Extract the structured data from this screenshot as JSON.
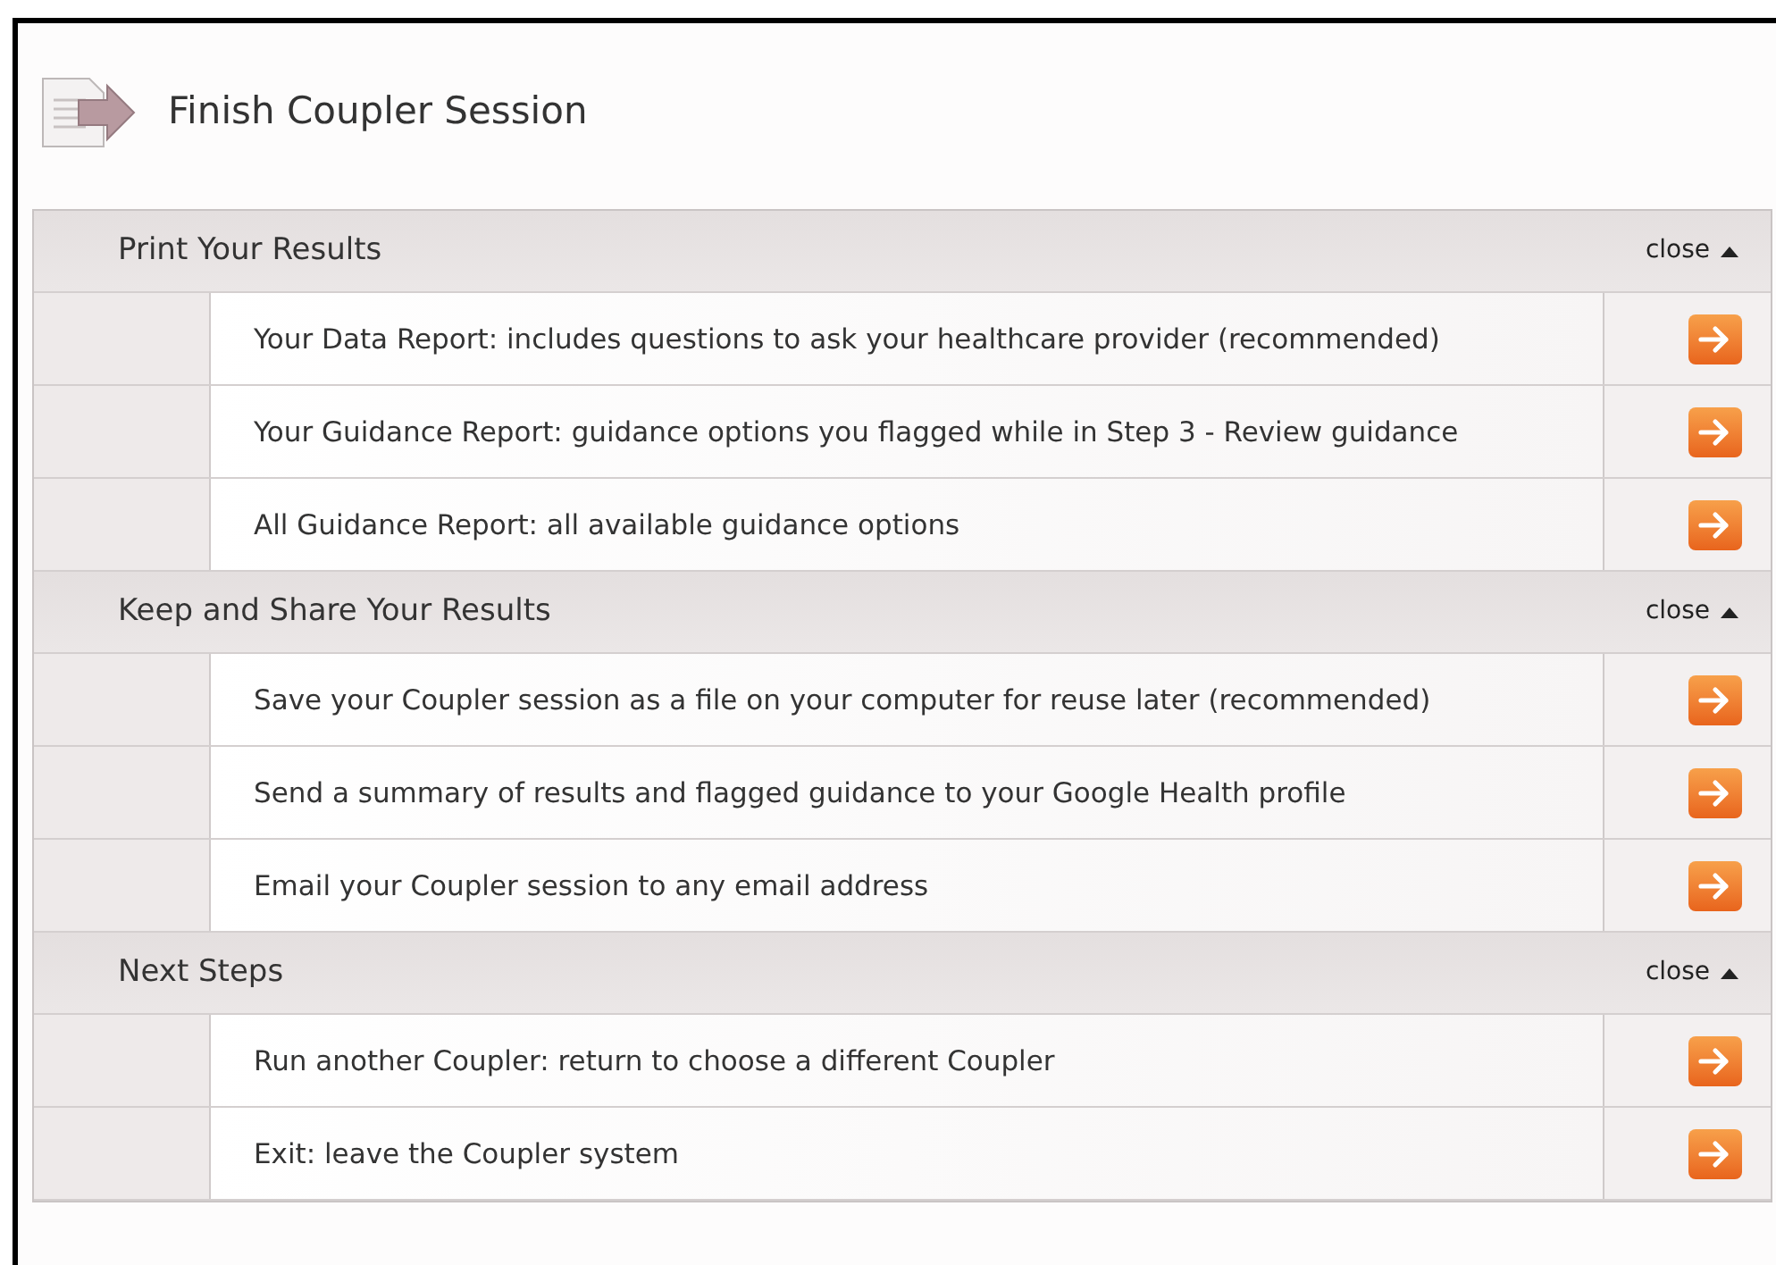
{
  "title": "Finish Coupler Session",
  "sections": [
    {
      "title": "Print Your Results",
      "toggle": "close",
      "expanded": true,
      "items": [
        {
          "label": "Your Data Report: includes questions to ask your healthcare provider (recommended)"
        },
        {
          "label": "Your Guidance Report: guidance options you flagged while in Step 3 - Review guidance"
        },
        {
          "label": "All Guidance Report: all available guidance options"
        }
      ]
    },
    {
      "title": "Keep and Share Your Results",
      "toggle": "close",
      "expanded": true,
      "items": [
        {
          "label": "Save your Coupler session as a file on your computer for reuse later (recommended)"
        },
        {
          "label": "Send a summary of results and flagged guidance to your Google Health profile"
        },
        {
          "label": "Email your Coupler session to any email address"
        }
      ]
    },
    {
      "title": "Next Steps",
      "toggle": "close",
      "expanded": true,
      "items": [
        {
          "label": "Run another Coupler: return to choose a different Coupler"
        },
        {
          "label": "Exit: leave the Coupler system"
        }
      ]
    }
  ]
}
